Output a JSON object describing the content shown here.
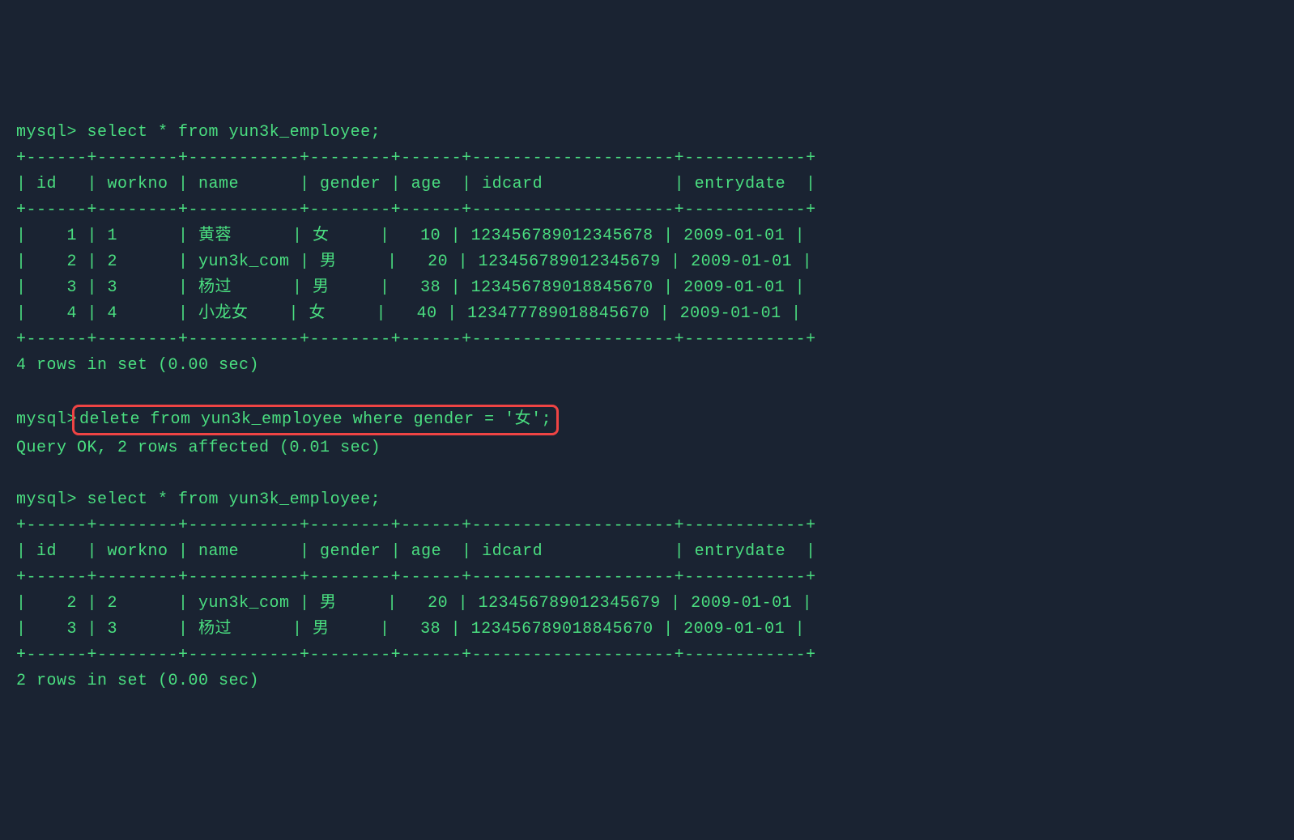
{
  "prompt": "mysql>",
  "query1": {
    "command": "select * from yun3k_employee;",
    "border_top": "+------+--------+-----------+--------+------+--------------------+------------+",
    "header": "| id   | workno | name      | gender | age  | idcard             | entrydate  |",
    "border_mid": "+------+--------+-----------+--------+------+--------------------+------------+",
    "rows": [
      "|    1 | 1      | 黄蓉      | 女     |   10 | 123456789012345678 | 2009-01-01 |",
      "|    2 | 2      | yun3k_com | 男     |   20 | 123456789012345679 | 2009-01-01 |",
      "|    3 | 3      | 杨过      | 男     |   38 | 123456789018845670 | 2009-01-01 |",
      "|    4 | 4      | 小龙女    | 女     |   40 | 123477789018845670 | 2009-01-01 |"
    ],
    "border_bot": "+------+--------+-----------+--------+------+--------------------+------------+",
    "result": "4 rows in set (0.00 sec)"
  },
  "query2": {
    "command": "delete from yun3k_employee where gender = '女';",
    "result": "Query OK, 2 rows affected (0.01 sec)"
  },
  "query3": {
    "command": "select * from yun3k_employee;",
    "border_top": "+------+--------+-----------+--------+------+--------------------+------------+",
    "header": "| id   | workno | name      | gender | age  | idcard             | entrydate  |",
    "border_mid": "+------+--------+-----------+--------+------+--------------------+------------+",
    "rows": [
      "|    2 | 2      | yun3k_com | 男     |   20 | 123456789012345679 | 2009-01-01 |",
      "|    3 | 3      | 杨过      | 男     |   38 | 123456789018845670 | 2009-01-01 |"
    ],
    "border_bot": "+------+--------+-----------+--------+------+--------------------+------------+",
    "result": "2 rows in set (0.00 sec)"
  }
}
